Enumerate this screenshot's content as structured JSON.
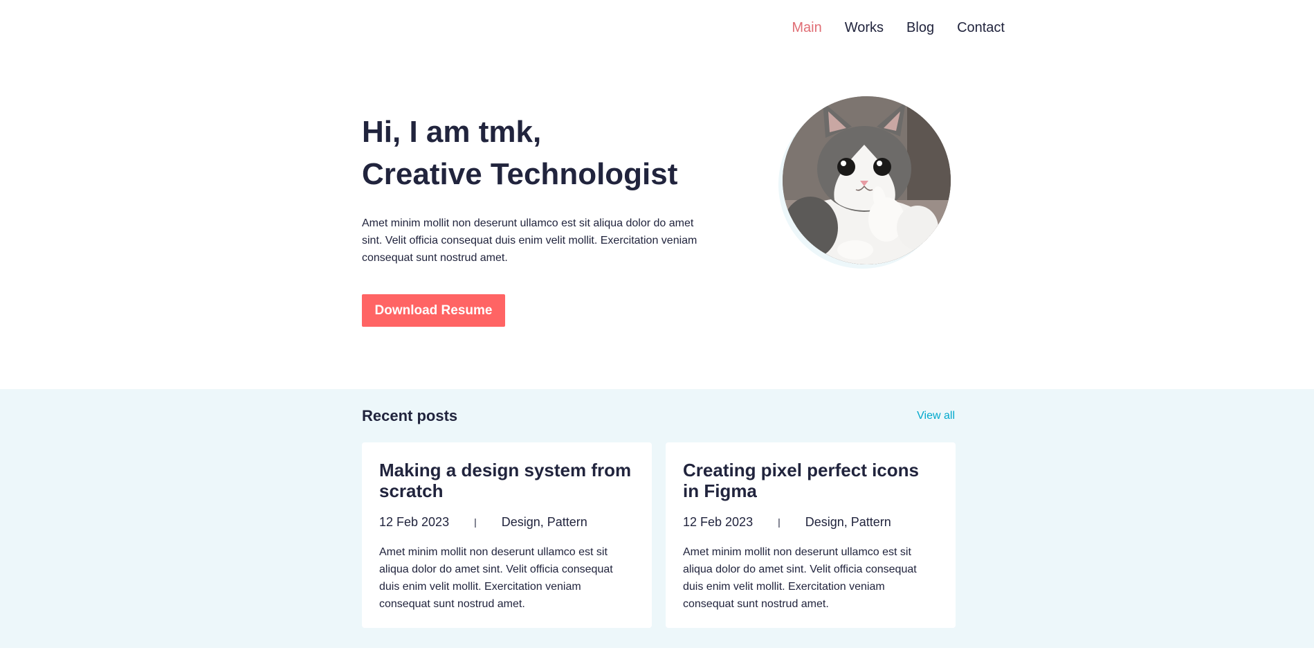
{
  "nav": {
    "items": [
      {
        "label": "Main",
        "active": true
      },
      {
        "label": "Works",
        "active": false
      },
      {
        "label": "Blog",
        "active": false
      },
      {
        "label": "Contact",
        "active": false
      }
    ]
  },
  "hero": {
    "title_line1": "Hi, I am tmk,",
    "title_line2": "Creative Technologist",
    "description": "Amet minim mollit non deserunt ullamco est sit aliqua dolor do amet sint. Velit officia consequat duis enim velit mollit. Exercitation veniam consequat sunt nostrud amet.",
    "button_label": "Download Resume"
  },
  "posts": {
    "title": "Recent posts",
    "view_all": "View all",
    "items": [
      {
        "title": "Making a design system from scratch",
        "date": "12 Feb 2023",
        "separator": "|",
        "tags": "Design, Pattern",
        "excerpt": "Amet minim mollit non deserunt ullamco est sit aliqua dolor do amet sint. Velit officia consequat duis enim velit mollit. Exercitation veniam consequat sunt nostrud amet."
      },
      {
        "title": "Creating pixel perfect icons in Figma",
        "date": "12 Feb 2023",
        "separator": "|",
        "tags": "Design, Pattern",
        "excerpt": "Amet minim mollit non deserunt ullamco est sit aliqua dolor do amet sint. Velit officia consequat duis enim velit mollit. Exercitation veniam consequat sunt nostrud amet."
      }
    ]
  },
  "colors": {
    "accent": "#ff6464",
    "nav_active": "#e06d74",
    "text": "#21243d",
    "link": "#00a8cc",
    "section_bg": "#edf7fa"
  }
}
